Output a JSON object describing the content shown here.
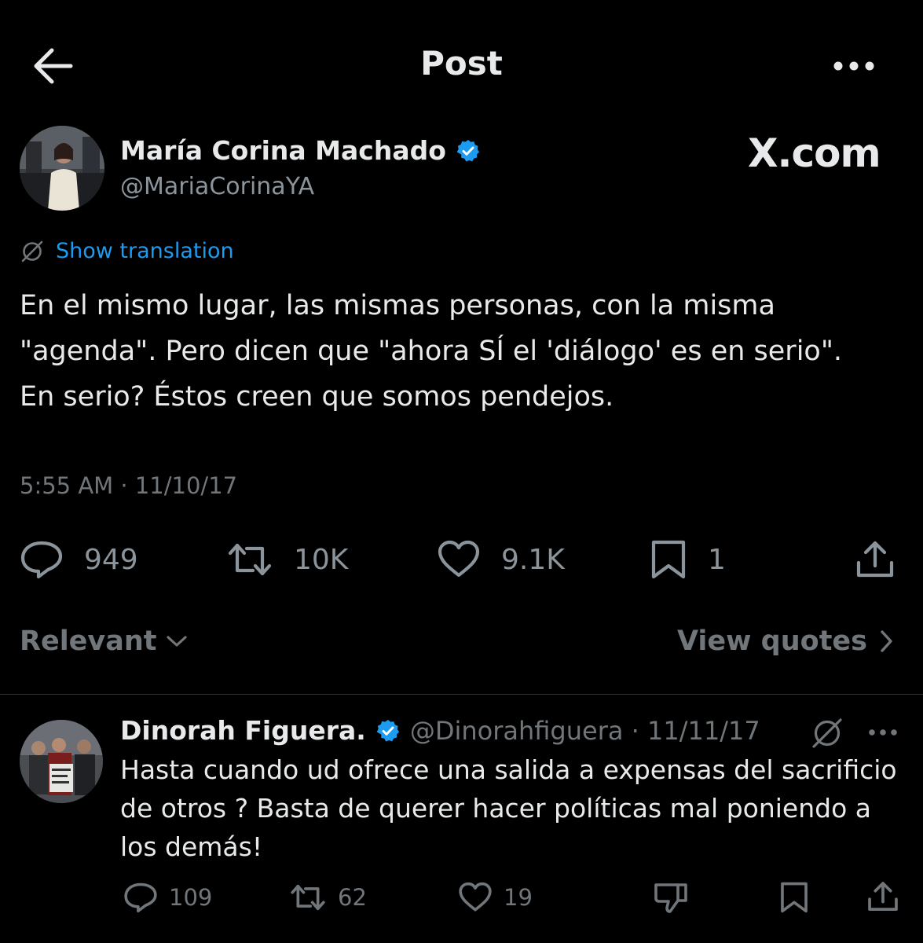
{
  "header": {
    "title": "Post",
    "back_icon": "arrow-left-icon",
    "more_icon": "more-horizontal-icon"
  },
  "post": {
    "author_name": "María Corina Machado",
    "author_handle": "@MariaCorinaYA",
    "verified_icon": "verified-badge-icon",
    "verified_color": "#1d9bf0",
    "watermark": "X.com",
    "show_translation": "Show translation",
    "text_lines": [
      "En el mismo lugar, las mismas personas, con la misma",
      "\"agenda\". Pero dicen que \"ahora SÍ el 'diálogo' es en serio\".",
      "En serio? Éstos creen que somos pendejos."
    ],
    "timestamp": "5:55 AM · 11/10/17",
    "stats": {
      "replies": "949",
      "reposts": "10K",
      "likes": "9.1K",
      "bookmarks": "1"
    }
  },
  "sort": {
    "label": "Relevant",
    "view_quotes": "View quotes"
  },
  "reply": {
    "author_name": "Dinorah Figuera.",
    "author_handle": "@Dinorahfiguera · 11/11/17",
    "text_lines": [
      "Hasta cuando ud ofrece una salida a expensas del sacrificio",
      "de otros ? Basta de querer hacer políticas mal poniendo a",
      "los demás!"
    ],
    "stats": {
      "replies": "109",
      "reposts": "62",
      "likes": "19"
    }
  },
  "colors": {
    "background": "#000000",
    "text_primary": "#e7e9ea",
    "text_secondary": "#71767b",
    "accent": "#1d9bf0",
    "divider": "#2f3336"
  }
}
